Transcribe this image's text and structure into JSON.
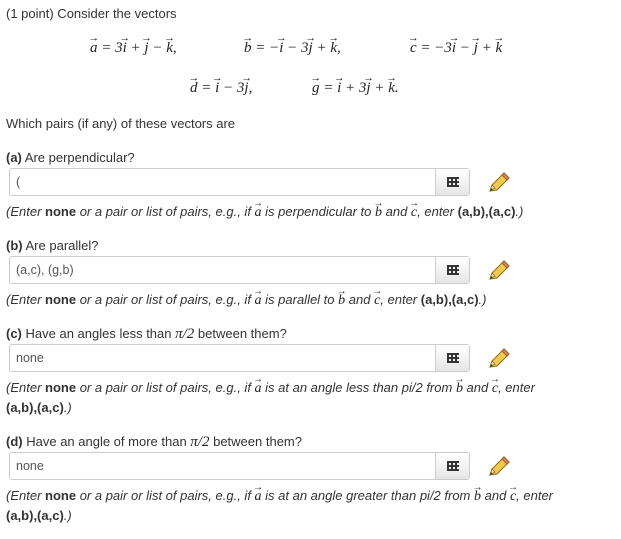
{
  "header": {
    "points": "(1 point) Consider the vectors",
    "vectors_line1": [
      "a = 3i + j − k,",
      "b = −i − 3j + k,",
      "c = −3i − j + k"
    ],
    "vectors_line2": [
      "d = i − 3j,",
      "g = i + 3j + k."
    ],
    "prompt": "Which pairs (if any) of these vectors are"
  },
  "parts": [
    {
      "letter": "(a)",
      "question": "Are perpendicular?",
      "value": "(",
      "hint_start": "(Enter ",
      "hint_none": "none",
      "hint_middle": " or a pair or list of pairs, e.g., if ",
      "hint_a": "a",
      "hint_relation": " is perpendicular to ",
      "hint_b": "b",
      "hint_and": " and ",
      "hint_c": "c",
      "hint_enter": ", enter ",
      "hint_example": "(a,b),(a,c)",
      "hint_end": ".)"
    },
    {
      "letter": "(b)",
      "question": "Are parallel?",
      "value": "(a,c), (g,b)",
      "hint_start": "(Enter ",
      "hint_none": "none",
      "hint_middle": " or a pair or list of pairs, e.g., if ",
      "hint_a": "a",
      "hint_relation": " is parallel to ",
      "hint_b": "b",
      "hint_and": " and ",
      "hint_c": "c",
      "hint_enter": ", enter ",
      "hint_example": "(a,b),(a,c)",
      "hint_end": ".)"
    },
    {
      "letter": "(c)",
      "question_pre": "Have an angles less than ",
      "question_math": "π/2",
      "question_post": " between them?",
      "value": "none",
      "hint_start": "(Enter ",
      "hint_none": "none",
      "hint_middle": " or a pair or list of pairs, e.g., if ",
      "hint_a": "a",
      "hint_relation": " is at an angle less than pi/2 from ",
      "hint_b": "b",
      "hint_and": " and ",
      "hint_c": "c",
      "hint_enter": ", enter",
      "hint_example": "(a,b),(a,c)",
      "hint_end": ".)"
    },
    {
      "letter": "(d)",
      "question_pre": "Have an angle of more than ",
      "question_math": "π/2",
      "question_post": " between them?",
      "value": "none",
      "hint_start": "(Enter ",
      "hint_none": "none",
      "hint_middle": " or a pair or list of pairs, e.g., if ",
      "hint_a": "a",
      "hint_relation": " is at an angle greater than pi/2 from ",
      "hint_b": "b",
      "hint_and": " and ",
      "hint_c": "c",
      "hint_enter": ", enter",
      "hint_example": "(a,b),(a,c)",
      "hint_end": ".)"
    }
  ],
  "icons": {
    "palette": "equation-palette-icon",
    "pencil": "pencil-icon"
  }
}
